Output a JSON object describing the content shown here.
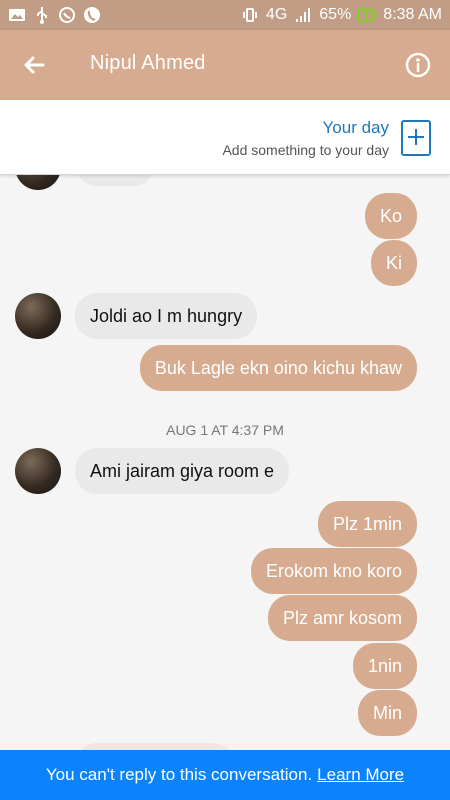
{
  "status_bar": {
    "network": "4G",
    "battery": "65%",
    "time": "8:38 AM"
  },
  "app_bar": {
    "contact_name": "Nipul Ahmed"
  },
  "your_day": {
    "title": "Your day",
    "subtitle": "Add something to your day"
  },
  "chat": {
    "sent_1": "Ko",
    "sent_2": "Ki",
    "received_1": "Joldi ao I m hungry",
    "sent_3": "Buk Lagle ekn oino kichu khaw",
    "date_label": "AUG 1 AT 4:37 PM",
    "received_2": "Ami jairam giya room e",
    "sent_4": "Plz 1min",
    "sent_5": "Erokom kno koro",
    "sent_6": "Plz amr kosom",
    "sent_7": "1nin",
    "sent_8": "Min"
  },
  "footer": {
    "message": "You can't reply to this conversation.",
    "link": "Learn More"
  },
  "colors": {
    "app_bar": "#d6ab8f",
    "status_bar": "#c09d84",
    "sent_bubble": "#d6ab8f",
    "received_bubble": "#e9e9e9",
    "footer": "#0b83fd",
    "accent_blue": "#1f78bd"
  },
  "icons": [
    "gallery-icon",
    "usb-icon",
    "whatsapp-icon",
    "phone-icon",
    "vibrate-icon",
    "signal-icon",
    "battery-icon",
    "back-arrow-icon",
    "info-icon",
    "plus-icon"
  ]
}
